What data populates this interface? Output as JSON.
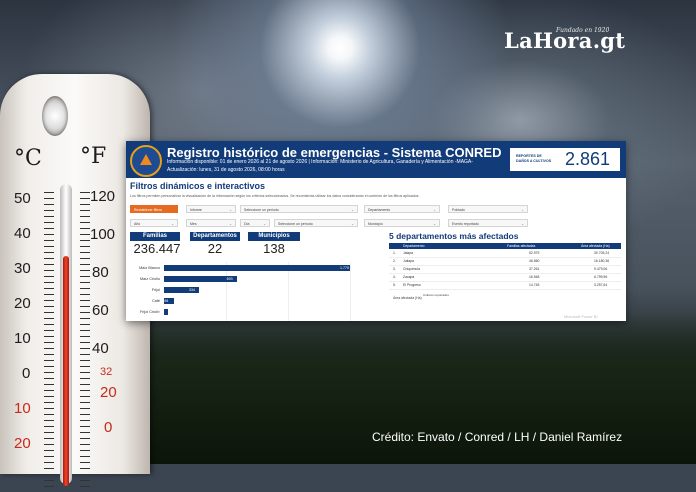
{
  "brand": {
    "name": "LaHora.gt",
    "tagline": "Fundado en 1920"
  },
  "credit": "Crédito: Envato / Conred / LH / Daniel Ramírez",
  "thermometer": {
    "celsius_symbol": "°C",
    "fahrenheit_symbol": "°F",
    "celsius_scale": [
      "50",
      "40",
      "30",
      "20",
      "10",
      "0",
      "10",
      "20"
    ],
    "fahrenheit_scale": [
      "120",
      "100",
      "80",
      "60",
      "40",
      "32",
      "20",
      "0"
    ]
  },
  "dashboard": {
    "title": "Registro histórico de emergencias - Sistema CONRED",
    "info_line": "Información disponible: 01 de enero 2026 al 21 de agosto 2026 | Información: Ministerio de Agricultura, Ganadería y Alimentación -MAGA-",
    "update_line": "Actualización: lunes, 31 de agosto 2026, 08:00 horas",
    "report_label": "REPORTES DE DAÑOS A CULTIVOS",
    "report_value": "2.861",
    "filters_title": "Filtros dinámicos e interactivos",
    "filters_desc": "Los filtros permiten personalizar la visualización de la información según los criterios seleccionados. Se recomienda utilizar los datos considerando el contexto de los filtros aplicados.",
    "reset_button": "Restablecer filtros",
    "filters": [
      "Informe",
      "Seleccione un período",
      "Departamento",
      "Poblado",
      "Mes",
      "Seleccione un período",
      "Municipio",
      "Evento reportado",
      "Año",
      "Día"
    ],
    "cards": [
      {
        "label": "Familias afectadas",
        "value": "236.447"
      },
      {
        "label": "Departamentos",
        "value": "22"
      },
      {
        "label": "Municipios",
        "value": "138"
      }
    ],
    "bars": [
      {
        "label": "Maíz Blanco",
        "value": 1775
      },
      {
        "label": "Maíz Criollo",
        "value": 693
      },
      {
        "label": "Frijol",
        "value": 334
      },
      {
        "label": "Café",
        "value": 98
      },
      {
        "label": "Frijol Criollo",
        "value": 39
      }
    ],
    "bars_max": 1775,
    "table_title": "5 departamentos más afectados",
    "table_headers": [
      "Departamento",
      "Familias afectadas",
      "Área afectada (Ha)"
    ],
    "table_rows": [
      {
        "n": "1.",
        "dep": "Jalapa",
        "fam": "52.979",
        "area": "30.705,24"
      },
      {
        "n": "2.",
        "dep": "Jutiapa",
        "fam": "46.560",
        "area": "16.180,36"
      },
      {
        "n": "3.",
        "dep": "Chiquimula",
        "fam": "37.261",
        "area": "9.479,06"
      },
      {
        "n": "4.",
        "dep": "Zacapa",
        "fam": "16.948",
        "area": "6.799,96"
      },
      {
        "n": "5.",
        "dep": "El Progreso",
        "fam": "14.745",
        "area": "3.257,64"
      }
    ],
    "area_label": "Área afectada (Ha)",
    "crops_label": "Cultivos reportados",
    "watermark": "Microsoft Power BI"
  }
}
